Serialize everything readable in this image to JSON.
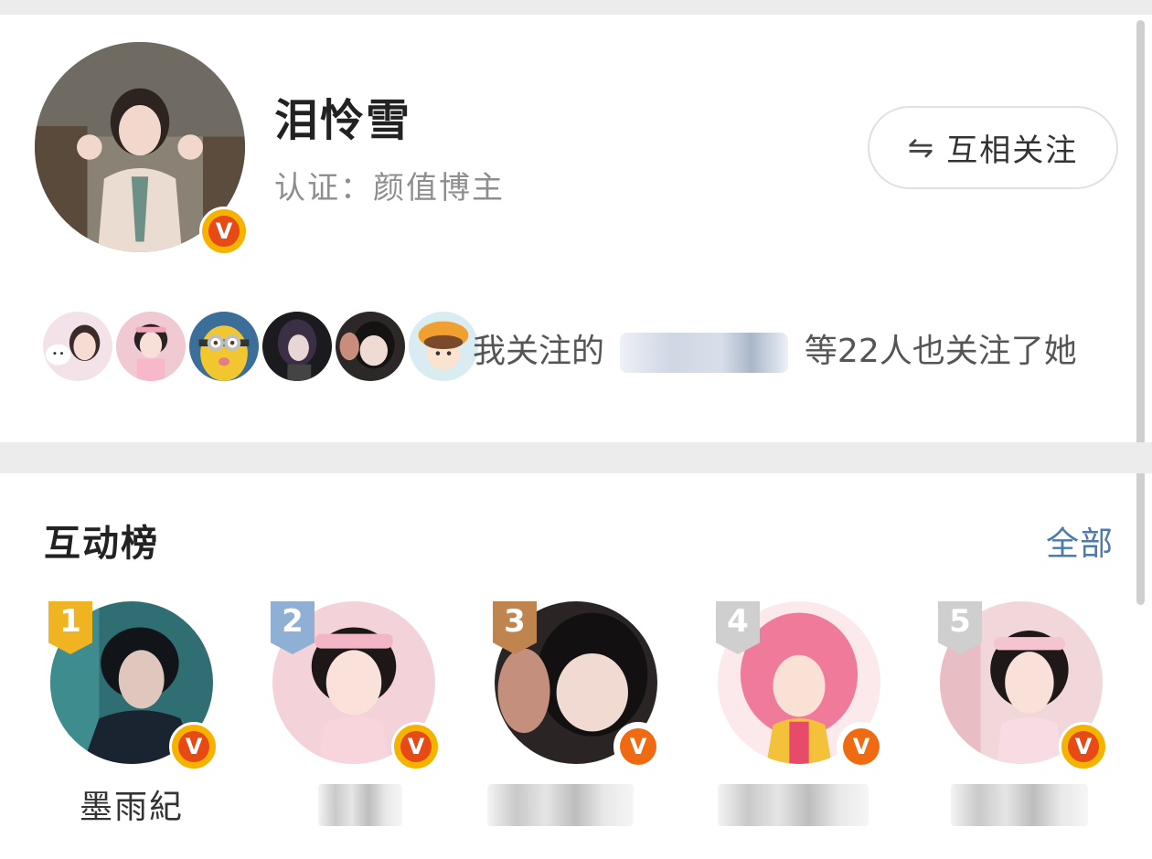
{
  "profile": {
    "name": "泪怜雪",
    "verification": "认证：颜值博主",
    "verified_badge": "V",
    "avatar_icon": "profile-avatar-photo"
  },
  "mutual_button": {
    "icon": "⇋",
    "label": "互相关注"
  },
  "followed_by": {
    "prefix": "我关注的",
    "suffix": "等22人也关注了她",
    "avatars": [
      "friend-avatar-1",
      "friend-avatar-2",
      "friend-avatar-3",
      "friend-avatar-4",
      "friend-avatar-5",
      "friend-avatar-6"
    ]
  },
  "interaction_ranking": {
    "title": "互动榜",
    "all_link": "全部",
    "items": [
      {
        "rank": "1",
        "name": "墨雨紀",
        "rank_color": "#f0b322",
        "verified_badge": "V"
      },
      {
        "rank": "2",
        "name": "",
        "rank_color": "#8fb0d4",
        "verified_badge": "V"
      },
      {
        "rank": "3",
        "name": "",
        "rank_color": "#c0844f",
        "verified_badge": "V"
      },
      {
        "rank": "4",
        "name": "",
        "rank_color": "#cfcfcf",
        "verified_badge": "V"
      },
      {
        "rank": "5",
        "name": "",
        "rank_color": "#cfcfcf",
        "verified_badge": "V"
      }
    ]
  },
  "colors": {
    "link": "#4a7ab0",
    "badge_yellow": "#f5b300",
    "badge_red": "#e84a16",
    "badge_orange": "#f06a12",
    "divider": "#ececec"
  }
}
